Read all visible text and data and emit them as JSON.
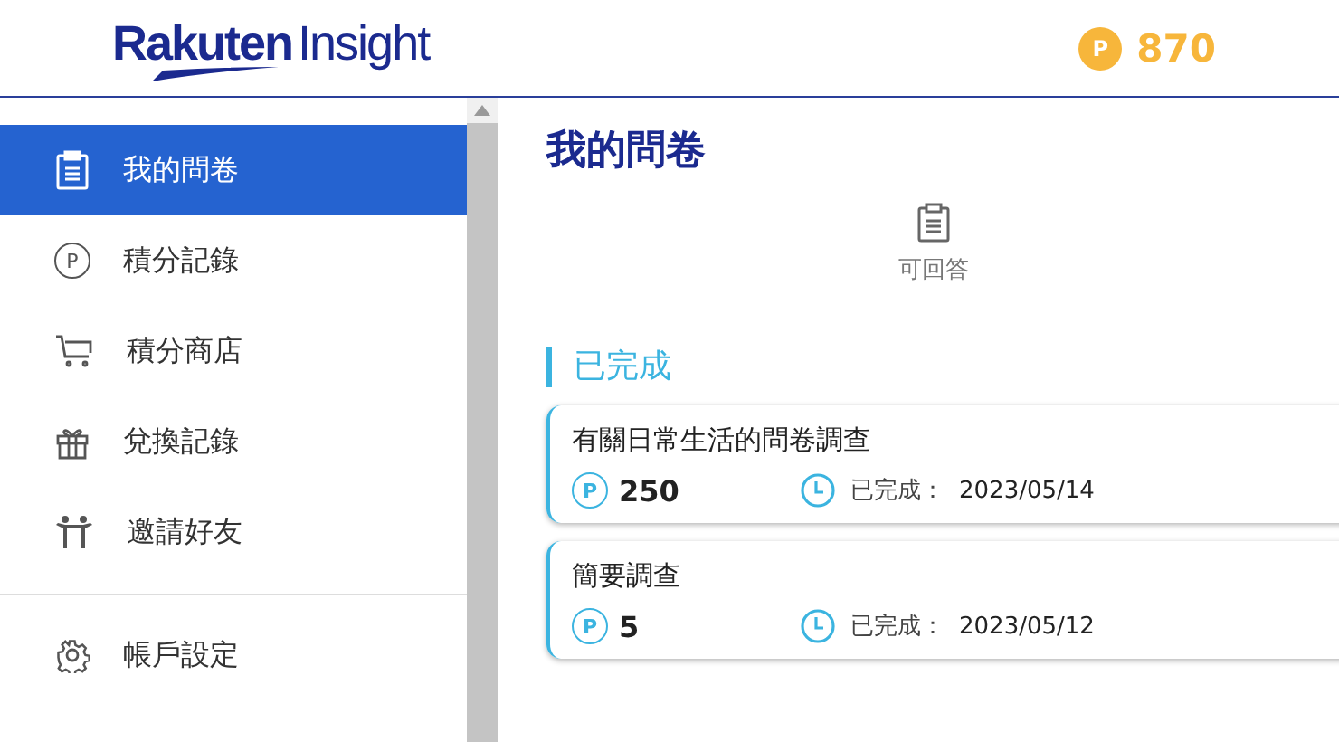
{
  "header": {
    "logo": {
      "brand": "Rakuten",
      "product": "Insight"
    },
    "points": {
      "symbol": "P",
      "value": "870"
    }
  },
  "sidebar": {
    "items": [
      {
        "kind": "clipboard",
        "label": "我的問卷",
        "selected": true
      },
      {
        "kind": "points",
        "label": "積分記錄",
        "selected": false,
        "symbol": "P"
      },
      {
        "kind": "cart",
        "label": "積分商店",
        "selected": false
      },
      {
        "kind": "gift",
        "label": "兌換記錄",
        "selected": false
      },
      {
        "kind": "people",
        "label": "邀請好友",
        "selected": false
      }
    ],
    "settings_items": [
      {
        "kind": "gear",
        "label": "帳戶設定",
        "selected": false
      }
    ]
  },
  "main": {
    "title": "我的問卷",
    "tab": {
      "label": "可回答"
    },
    "section": "已完成",
    "surveys": [
      {
        "title": "有關日常生活的問卷調查",
        "symbol": "P",
        "points": "250",
        "status": "已完成：",
        "date": "2023/05/14"
      },
      {
        "title": "簡要調查",
        "symbol": "P",
        "points": "5",
        "status": "已完成：",
        "date": "2023/05/12"
      }
    ]
  }
}
